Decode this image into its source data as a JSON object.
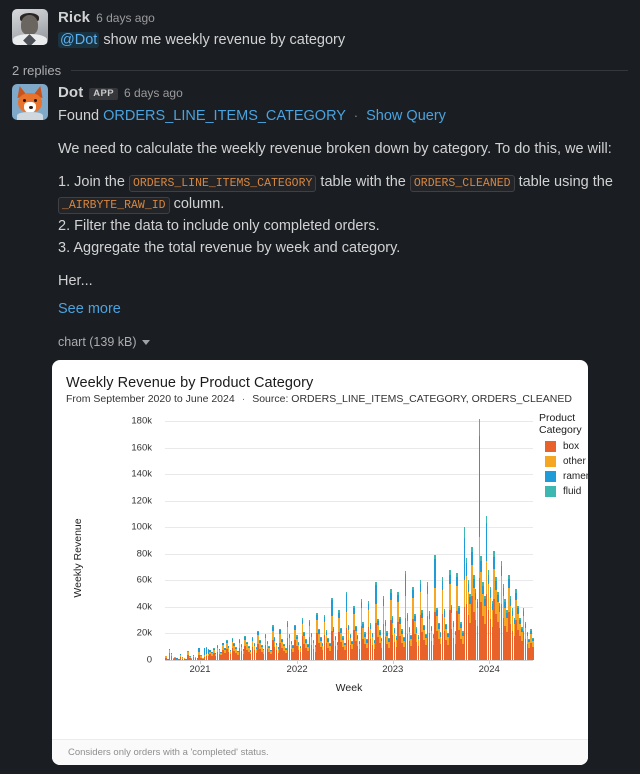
{
  "theme": {
    "bg": "#1a1d21",
    "text": "#d1d2d3",
    "muted": "#9a9b9e",
    "link": "#4aa3df",
    "code": "#d9873f"
  },
  "root_message": {
    "author": "Rick",
    "timestamp": "6 days ago",
    "avatar_icon": "user-avatar-rick",
    "mention": "@Dot",
    "text": "show me weekly revenue by category"
  },
  "thread": {
    "replies_label": "2 replies"
  },
  "reply_message": {
    "author": "Dot",
    "app_badge": "APP",
    "timestamp": "6 days ago",
    "avatar_icon": "bot-avatar-fox",
    "found_prefix": "Found",
    "found_table": "ORDERS_LINE_ITEMS_CATEGORY",
    "separator": "·",
    "show_query_label": "Show Query",
    "intro": "We need to calculate the weekly revenue broken down by category. To do this, we will:",
    "steps": [
      {
        "num": "1.",
        "pre": "Join the",
        "code1": "ORDERS_LINE_ITEMS_CATEGORY",
        "mid": "table with the",
        "code2": "ORDERS_CLEANED",
        "post": "table using the",
        "code3": "_AIRBYTE_RAW_ID",
        "tail": "column."
      },
      {
        "num": "2.",
        "text": "Filter the data to include only completed orders."
      },
      {
        "num": "3.",
        "text": "Aggregate the total revenue by week and category."
      }
    ],
    "truncated_text": "Her...",
    "see_more_label": "See more"
  },
  "attachment": {
    "filename_label": "chart (139 kB)",
    "caret_icon": "chevron-down-icon"
  },
  "chart_data": {
    "type": "bar",
    "stacked": true,
    "title": "Weekly Revenue by Product Category",
    "subtitle_range": "From September 2020 to June 2024",
    "subtitle_sep": "·",
    "subtitle_source": "Source: ORDERS_LINE_ITEMS_CATEGORY, ORDERS_CLEANED",
    "footnote": "Considers only orders with a 'completed' status.",
    "xlabel": "Week",
    "ylabel": "Weekly Revenue",
    "legend_title": "Product Category",
    "legend_position": "right",
    "grid": true,
    "ylim": [
      0,
      190000
    ],
    "yticks": [
      0,
      20000,
      40000,
      60000,
      80000,
      100000,
      120000,
      140000,
      160000,
      180000
    ],
    "ytick_labels": [
      "0",
      "20k",
      "40k",
      "60k",
      "80k",
      "100k",
      "120k",
      "140k",
      "160k",
      "180k"
    ],
    "xtick_labels": [
      "2021",
      "2022",
      "2023",
      "2024"
    ],
    "xtick_positions": [
      0.0952,
      0.359,
      0.619,
      0.881
    ],
    "series": [
      {
        "name": "box",
        "color": "#e8622a"
      },
      {
        "name": "other",
        "color": "#f5a623"
      },
      {
        "name": "ramen",
        "color": "#1f9cd8"
      },
      {
        "name": "fluid",
        "color": "#3cb8b0"
      }
    ],
    "n_bars": 196,
    "values": [
      [
        1800,
        900,
        400,
        200
      ],
      [
        600,
        300,
        150,
        80
      ],
      [
        5200,
        2400,
        600,
        300
      ],
      [
        3100,
        1500,
        400,
        200
      ],
      [
        900,
        500,
        200,
        100
      ],
      [
        1400,
        700,
        250,
        120
      ],
      [
        700,
        400,
        150,
        80
      ],
      [
        500,
        250,
        100,
        60
      ],
      [
        2600,
        1300,
        400,
        200
      ],
      [
        1100,
        600,
        200,
        100
      ],
      [
        800,
        400,
        150,
        80
      ],
      [
        600,
        300,
        120,
        60
      ],
      [
        3900,
        1900,
        500,
        250
      ],
      [
        1500,
        800,
        300,
        150
      ],
      [
        900,
        450,
        180,
        90
      ],
      [
        2200,
        1100,
        350,
        180
      ],
      [
        1300,
        700,
        250,
        120
      ],
      [
        700,
        350,
        140,
        70
      ],
      [
        4100,
        2000,
        2600,
        300
      ],
      [
        1800,
        900,
        600,
        200
      ],
      [
        1000,
        500,
        200,
        100
      ],
      [
        2400,
        1200,
        5200,
        400
      ],
      [
        3000,
        1500,
        4900,
        600
      ],
      [
        2800,
        1400,
        3600,
        500
      ],
      [
        4200,
        2100,
        900,
        400
      ],
      [
        3400,
        1700,
        700,
        300
      ],
      [
        5100,
        2600,
        1000,
        450
      ],
      [
        2900,
        1500,
        600,
        260
      ],
      [
        6200,
        3100,
        1200,
        520
      ],
      [
        4800,
        2400,
        950,
        400
      ],
      [
        3600,
        1800,
        700,
        320
      ],
      [
        7400,
        3700,
        1400,
        620
      ],
      [
        5200,
        2600,
        1000,
        440
      ],
      [
        8600,
        4300,
        1700,
        740
      ],
      [
        6100,
        3100,
        1200,
        520
      ],
      [
        4300,
        2200,
        850,
        380
      ],
      [
        9200,
        4600,
        1800,
        800
      ],
      [
        7000,
        3500,
        1400,
        600
      ],
      [
        5400,
        2700,
        1100,
        480
      ],
      [
        3900,
        2000,
        800,
        340
      ],
      [
        8800,
        4400,
        1700,
        760
      ],
      [
        6600,
        3300,
        1300,
        560
      ],
      [
        4700,
        2400,
        950,
        410
      ],
      [
        10200,
        5100,
        2000,
        880
      ],
      [
        7800,
        3900,
        1500,
        660
      ],
      [
        5900,
        3000,
        1200,
        510
      ],
      [
        4200,
        2100,
        850,
        360
      ],
      [
        9600,
        4800,
        1900,
        820
      ],
      [
        7200,
        3600,
        1400,
        620
      ],
      [
        5500,
        2800,
        1100,
        470
      ],
      [
        12400,
        6200,
        2400,
        1060
      ],
      [
        8400,
        4200,
        1700,
        720
      ],
      [
        6300,
        3200,
        1250,
        540
      ],
      [
        4800,
        2400,
        950,
        410
      ],
      [
        11000,
        5500,
        2100,
        940
      ],
      [
        8000,
        4000,
        1600,
        680
      ],
      [
        6000,
        3000,
        1200,
        510
      ],
      [
        4400,
        2200,
        880,
        380
      ],
      [
        14800,
        7400,
        2900,
        1260
      ],
      [
        9800,
        4900,
        1900,
        840
      ],
      [
        7400,
        3700,
        1450,
        630
      ],
      [
        5600,
        2800,
        1100,
        480
      ],
      [
        13200,
        6600,
        2600,
        1120
      ],
      [
        9000,
        4500,
        1800,
        770
      ],
      [
        6800,
        3400,
        1350,
        580
      ],
      [
        5000,
        2500,
        1000,
        430
      ],
      [
        16400,
        8200,
        3200,
        1400
      ],
      [
        11200,
        5600,
        2200,
        950
      ],
      [
        8200,
        4100,
        1600,
        700
      ],
      [
        6200,
        3100,
        1200,
        530
      ],
      [
        15000,
        7500,
        2900,
        1280
      ],
      [
        10400,
        5200,
        2050,
        880
      ],
      [
        7600,
        3800,
        1500,
        650
      ],
      [
        5800,
        2900,
        1150,
        490
      ],
      [
        18000,
        9000,
        3500,
        1540
      ],
      [
        12000,
        6000,
        2350,
        1020
      ],
      [
        8800,
        4400,
        1750,
        750
      ],
      [
        6600,
        3300,
        1300,
        560
      ],
      [
        17000,
        8500,
        3300,
        1450
      ],
      [
        11600,
        5800,
        2300,
        980
      ],
      [
        8400,
        4200,
        1650,
        710
      ],
      [
        6400,
        3200,
        1250,
        540
      ],
      [
        20000,
        10000,
        3900,
        1700
      ],
      [
        13200,
        6600,
        2600,
        1120
      ],
      [
        9600,
        4800,
        1900,
        810
      ],
      [
        7200,
        3600,
        1400,
        610
      ],
      [
        19000,
        9500,
        3700,
        1620
      ],
      [
        12600,
        6300,
        2450,
        1060
      ],
      [
        9200,
        4600,
        1800,
        780
      ],
      [
        7000,
        3500,
        1380,
        590
      ],
      [
        22000,
        11000,
        12000,
        1900
      ],
      [
        14000,
        7000,
        2700,
        1180
      ],
      [
        10200,
        5100,
        2000,
        870
      ],
      [
        7600,
        3800,
        1500,
        640
      ],
      [
        21000,
        10500,
        4100,
        1790
      ],
      [
        13600,
        6800,
        2650,
        1150
      ],
      [
        10000,
        5000,
        1950,
        840
      ],
      [
        7400,
        3700,
        1450,
        620
      ],
      [
        24000,
        12000,
        13500,
        2050
      ],
      [
        15000,
        7500,
        2950,
        1270
      ],
      [
        11000,
        5500,
        2150,
        930
      ],
      [
        8200,
        4100,
        1600,
        690
      ],
      [
        23000,
        11500,
        4500,
        1960
      ],
      [
        14600,
        7300,
        2850,
        1230
      ],
      [
        10600,
        5300,
        2080,
        890
      ],
      [
        8000,
        4000,
        1570,
        670
      ],
      [
        26000,
        13000,
        5100,
        2210
      ],
      [
        16200,
        8100,
        3150,
        1370
      ],
      [
        11800,
        5900,
        2300,
        990
      ],
      [
        8800,
        4400,
        1720,
        740
      ],
      [
        25000,
        12500,
        4900,
        2120
      ],
      [
        15800,
        7900,
        3080,
        1330
      ],
      [
        11400,
        5700,
        2240,
        960
      ],
      [
        8600,
        4300,
        1680,
        720
      ],
      [
        28000,
        14000,
        14500,
        2380
      ],
      [
        17400,
        8700,
        3400,
        1470
      ],
      [
        12600,
        6300,
        2470,
        1060
      ],
      [
        9400,
        4700,
        1840,
        790
      ],
      [
        27000,
        13500,
        5300,
        2290
      ],
      [
        17000,
        8500,
        3320,
        1430
      ],
      [
        12200,
        6100,
        2390,
        1030
      ],
      [
        9200,
        4600,
        1800,
        770
      ],
      [
        30000,
        15000,
        5900,
        2550
      ],
      [
        18600,
        9300,
        3640,
        1570
      ],
      [
        13400,
        6700,
        2620,
        1130
      ],
      [
        10000,
        5000,
        1960,
        840
      ],
      [
        29000,
        14500,
        5700,
        2460
      ],
      [
        18200,
        9100,
        3560,
        1530
      ],
      [
        13000,
        6500,
        2540,
        1090
      ],
      [
        9800,
        4900,
        1920,
        820
      ],
      [
        32000,
        16000,
        16500,
        2720
      ],
      [
        19800,
        9900,
        3880,
        1670
      ],
      [
        14200,
        7100,
        2780,
        1200
      ],
      [
        10600,
        5300,
        2080,
        890
      ],
      [
        31000,
        15500,
        6100,
        2630
      ],
      [
        19400,
        9700,
        3800,
        1630
      ],
      [
        13800,
        6900,
        2700,
        1160
      ],
      [
        10400,
        5200,
        2040,
        870
      ],
      [
        34000,
        17000,
        6650,
        2870
      ],
      [
        21000,
        10500,
        4110,
        1770
      ],
      [
        15000,
        7500,
        2940,
        1260
      ],
      [
        11200,
        5600,
        2200,
        940
      ],
      [
        33000,
        16500,
        6460,
        2780
      ],
      [
        20600,
        10300,
        4030,
        1730
      ],
      [
        14600,
        7300,
        2860,
        1230
      ],
      [
        11000,
        5500,
        2160,
        920
      ],
      [
        36000,
        18000,
        22000,
        3060
      ],
      [
        22200,
        11100,
        4350,
        1870
      ],
      [
        15800,
        7900,
        3100,
        1330
      ],
      [
        11800,
        5900,
        2310,
        990
      ],
      [
        35000,
        17500,
        6850,
        2950
      ],
      [
        21800,
        10900,
        4270,
        1830
      ],
      [
        15400,
        7700,
        3020,
        1300
      ],
      [
        11600,
        5800,
        2270,
        970
      ],
      [
        38000,
        19000,
        7440,
        3210
      ],
      [
        23400,
        11700,
        4580,
        1970
      ],
      [
        16600,
        8300,
        3250,
        1400
      ],
      [
        12400,
        6200,
        2430,
        1040
      ],
      [
        37000,
        18500,
        7250,
        3120
      ],
      [
        23000,
        11500,
        4500,
        1930
      ],
      [
        16200,
        8100,
        3170,
        1360
      ],
      [
        12200,
        6100,
        2390,
        1020
      ],
      [
        40000,
        20000,
        32000,
        8200
      ],
      [
        42000,
        21000,
        9800,
        4200
      ],
      [
        34000,
        17000,
        6660,
        2870
      ],
      [
        28000,
        14000,
        5490,
        2360
      ],
      [
        48000,
        24000,
        9400,
        4040
      ],
      [
        36000,
        18000,
        7050,
        3030
      ],
      [
        30000,
        15000,
        5880,
        2530
      ],
      [
        26000,
        13000,
        5090,
        2190
      ],
      [
        62000,
        31000,
        76000,
        13000
      ],
      [
        44000,
        22000,
        8620,
        3710
      ],
      [
        33000,
        16500,
        6470,
        2780
      ],
      [
        27000,
        13500,
        5290,
        2280
      ],
      [
        50000,
        25000,
        28000,
        5400
      ],
      [
        38000,
        19000,
        7450,
        3200
      ],
      [
        31000,
        15500,
        6080,
        2610
      ],
      [
        25000,
        12500,
        4900,
        2110
      ],
      [
        46000,
        23000,
        9010,
        3880
      ],
      [
        35000,
        17500,
        6860,
        2950
      ],
      [
        29000,
        14500,
        5680,
        2440
      ],
      [
        24000,
        12000,
        4700,
        2020
      ],
      [
        42000,
        21000,
        8230,
        3540
      ],
      [
        32000,
        16000,
        6270,
        2700
      ],
      [
        26000,
        13000,
        5090,
        2190
      ],
      [
        21000,
        10500,
        4110,
        1770
      ],
      [
        36000,
        18000,
        7050,
        3030
      ],
      [
        27000,
        13500,
        5290,
        2280
      ],
      [
        22000,
        11000,
        4310,
        1850
      ],
      [
        18000,
        9000,
        3530,
        1520
      ],
      [
        30000,
        15000,
        5880,
        2530
      ],
      [
        23000,
        11500,
        4500,
        1940
      ],
      [
        18000,
        9000,
        3530,
        1520
      ],
      [
        14000,
        7000,
        2740,
        1180
      ],
      [
        22000,
        11000,
        4310,
        1850
      ],
      [
        16000,
        8000,
        3140,
        1350
      ],
      [
        12000,
        6000,
        2350,
        1010
      ],
      [
        9000,
        4500,
        1760,
        760
      ],
      [
        13000,
        6500,
        2550,
        1100
      ],
      [
        9500,
        4750,
        1860,
        800
      ]
    ]
  }
}
